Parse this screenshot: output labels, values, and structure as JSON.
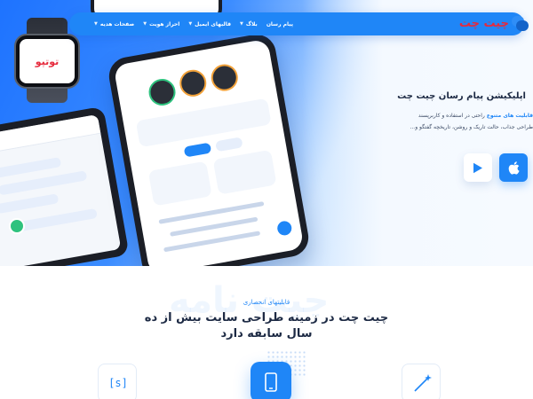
{
  "brand": {
    "logo_text": "چیت چت",
    "watch_logo": "توتپو",
    "accent": "#1f86f7",
    "logo_red": "#e62a3c"
  },
  "nav": {
    "items": [
      {
        "label": "پیام رسان",
        "has_dropdown": false
      },
      {
        "label": "بلاگ",
        "has_dropdown": true
      },
      {
        "label": "قالبهای ایمیل",
        "has_dropdown": true
      },
      {
        "label": "احراز هویت",
        "has_dropdown": true
      },
      {
        "label": "صفحات هدیه",
        "has_dropdown": true
      }
    ]
  },
  "hero": {
    "title": "اپلیکیشن پیام رسان چیت چت",
    "desc_line1_prefix": "قابلیت های متنوع",
    "desc_line1_rest": " راحتی در استفاده و کاربرپسند",
    "desc_line2": "طراحی جذاب، حالت تاریک و روشن، تاریخچه گفتگو و...",
    "store_buttons": [
      {
        "icon": "apple-icon"
      },
      {
        "icon": "play-store-icon"
      }
    ]
  },
  "section": {
    "watermark": "چیت نامه",
    "tagline": "قابلیتهای انحصاری",
    "heading": "چیت چت در زمینه طراحی سایت بیش از ده سال سابقه دارد",
    "features": [
      {
        "icon": "code-bracket-icon",
        "symbol": "[s]"
      },
      {
        "icon": "mobile-phone-icon"
      },
      {
        "icon": "magic-wand-icon"
      }
    ]
  }
}
